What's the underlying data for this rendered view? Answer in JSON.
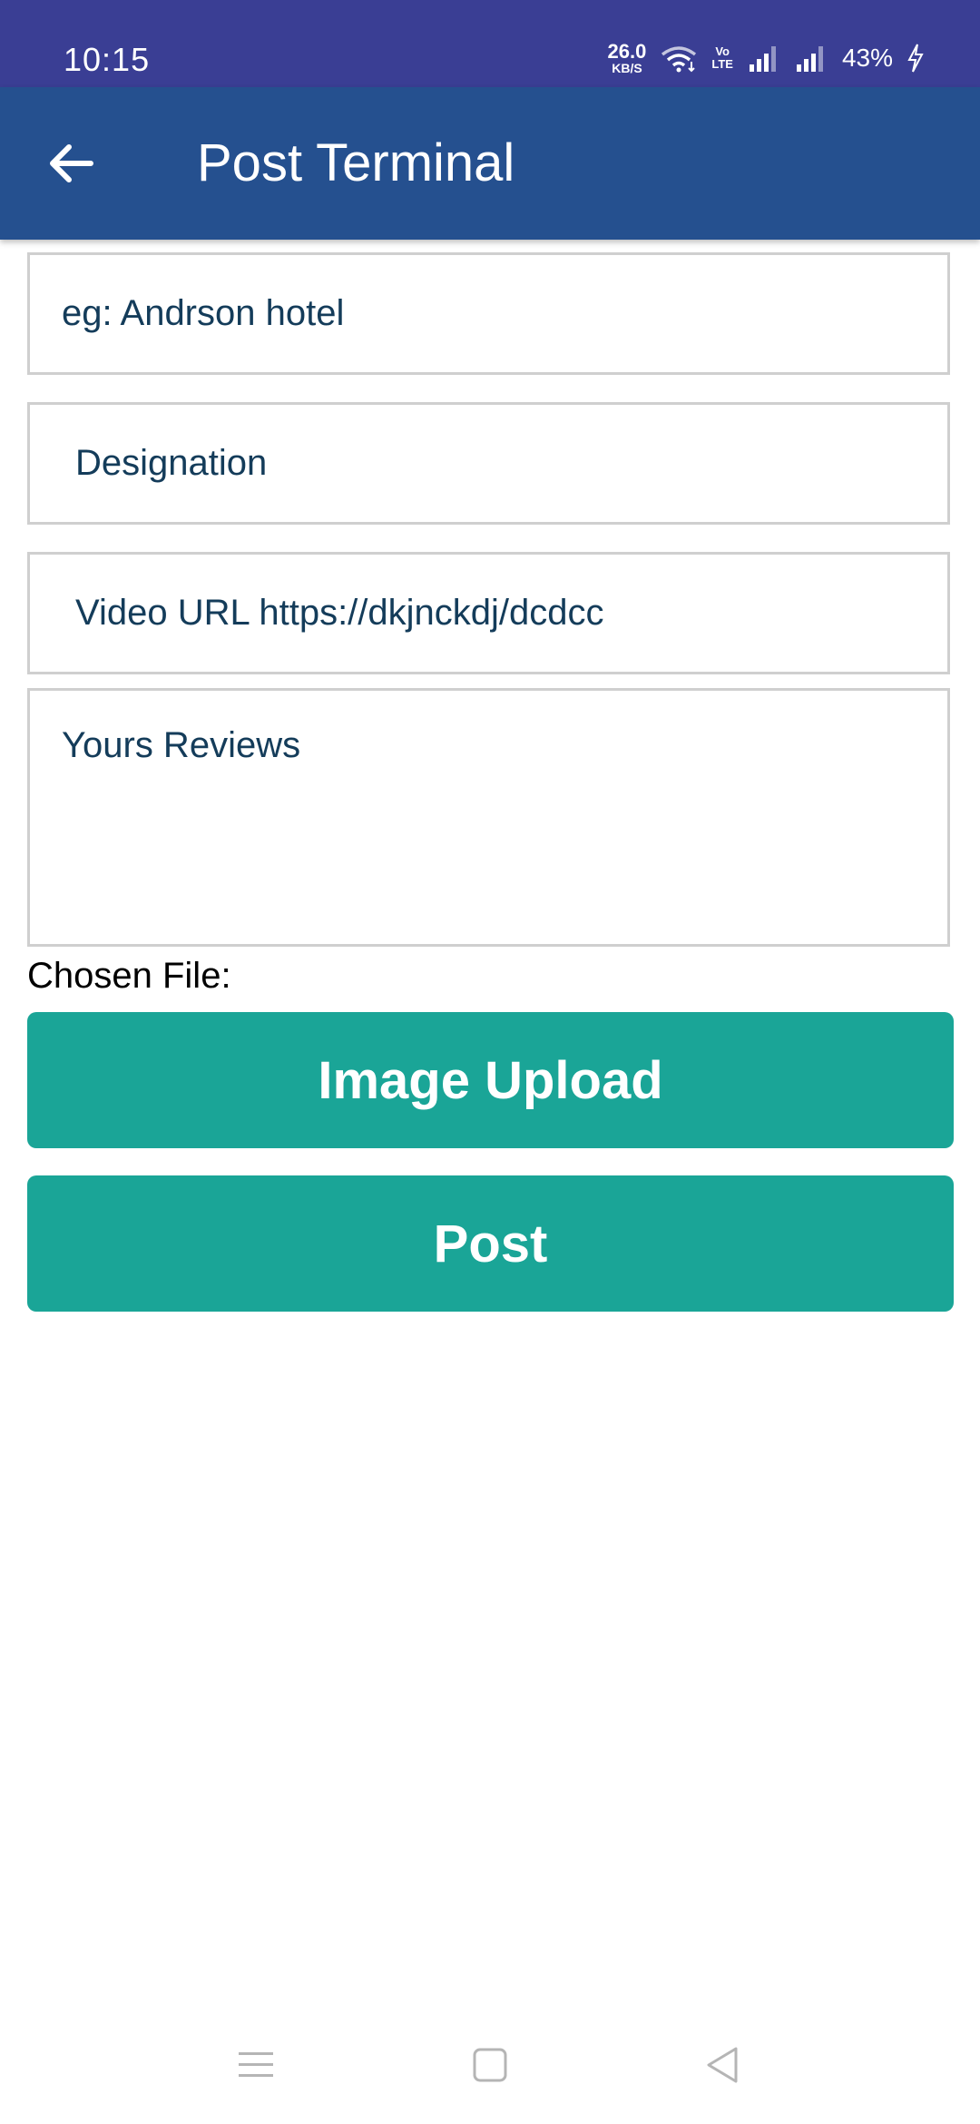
{
  "status_bar": {
    "time": "10:15",
    "network_speed": "26.0",
    "network_speed_unit": "KB/S",
    "volte_top": "Vo",
    "volte_bottom": "LTE",
    "battery": "43%",
    "icons": [
      "wifi-icon",
      "signal-icon",
      "signal-icon",
      "charging-icon"
    ]
  },
  "app_bar": {
    "title": "Post Terminal",
    "back_icon": "arrow-back-icon"
  },
  "form": {
    "name_placeholder": "eg: Andrson hotel",
    "designation_placeholder": "Designation",
    "video_url_placeholder": "Video URL  https://dkjnckdj/dcdcc",
    "reviews_placeholder": "Yours Reviews",
    "chosen_file_label": "Chosen File:"
  },
  "buttons": {
    "image_upload": "Image Upload",
    "post": "Post"
  },
  "nav_bar": {
    "icons": [
      "menu-icon",
      "home-icon",
      "back-triangle-icon"
    ]
  },
  "colors": {
    "status_bar": "#3a3e94",
    "app_bar": "#25508f",
    "button": "#1aa597",
    "field_text": "#143c5a",
    "field_border": "#cfcfcf"
  }
}
